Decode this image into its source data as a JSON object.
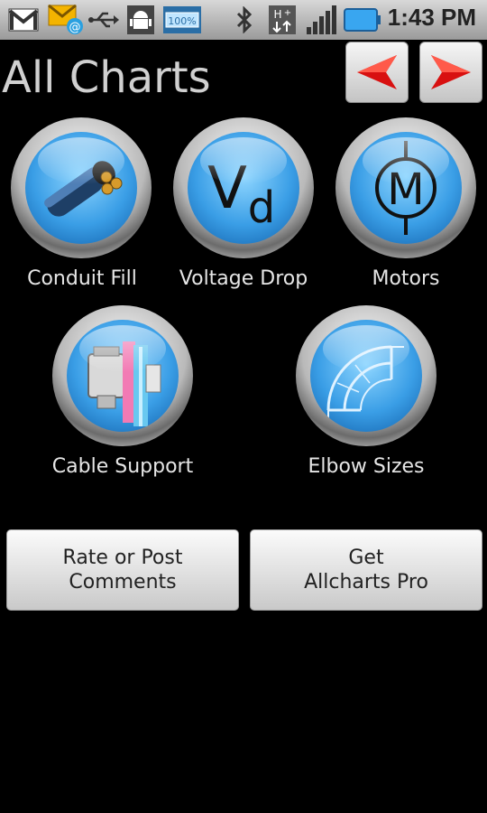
{
  "status_bar": {
    "time": "1:43 PM",
    "battery_text": "100%",
    "icons": [
      "gmail-icon",
      "new-email-icon",
      "usb-icon",
      "android-debug-icon",
      "battery-percent-icon",
      "bluetooth-icon",
      "hplus-data-icon",
      "signal-icon",
      "battery-icon"
    ]
  },
  "header": {
    "title": "All Charts",
    "prev_icon": "left-arrow-icon",
    "next_icon": "right-arrow-icon",
    "accent_color": "#d81010"
  },
  "charts": [
    {
      "label": "Conduit Fill",
      "icon": "conduit-cable-icon"
    },
    {
      "label": "Voltage Drop",
      "icon": "vd-icon",
      "glyph_main": "V",
      "glyph_sub": "d"
    },
    {
      "label": "Motors",
      "icon": "motor-icon",
      "glyph_main": "M"
    },
    {
      "label": "Cable Support",
      "icon": "cable-support-icon"
    },
    {
      "label": "Elbow Sizes",
      "icon": "elbow-icon"
    }
  ],
  "buttons": {
    "rate": {
      "line1": "Rate or Post",
      "line2": "Comments"
    },
    "pro": {
      "line1": "Get",
      "line2": "Allcharts Pro"
    }
  }
}
